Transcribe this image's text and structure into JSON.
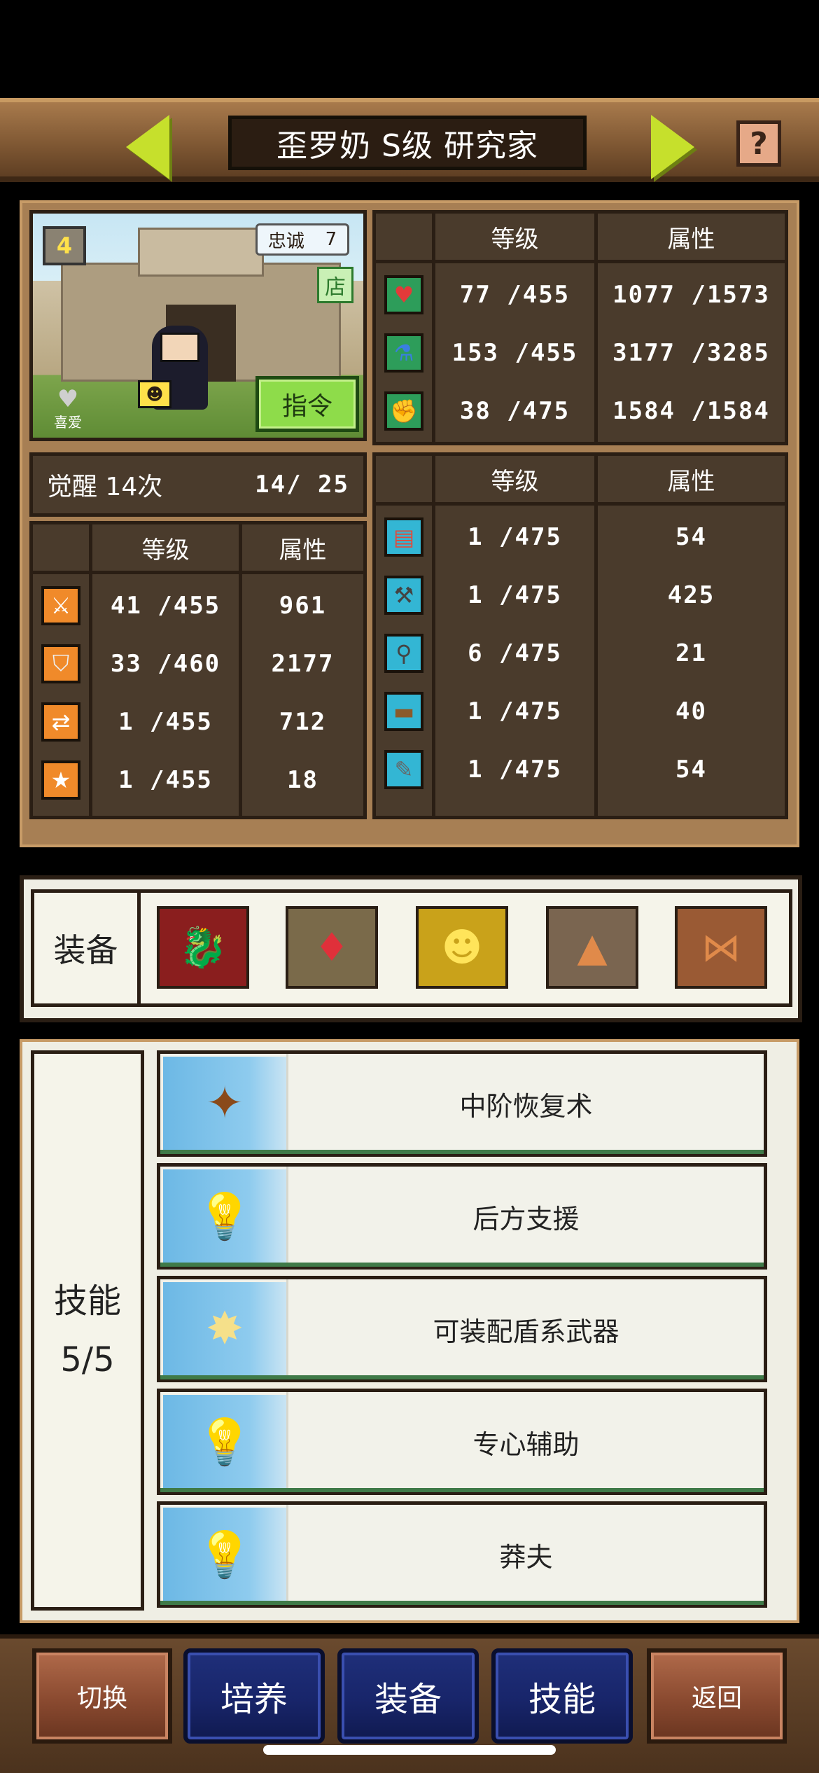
{
  "header": {
    "title": "歪罗奶 S级 研究家",
    "prev_icon": "left-arrow-icon",
    "next_icon": "right-arrow-icon",
    "help_label": "?"
  },
  "portrait": {
    "level_badge": "4",
    "loyalty_label": "忠诚",
    "loyalty_value": "7",
    "shop_label": "店",
    "favorite_label": "喜爱",
    "command_label": "指令"
  },
  "top_stats": {
    "headers": {
      "level": "等级",
      "attr": "属性"
    },
    "rows": [
      {
        "icon": "heart-icon",
        "level": "77 /455",
        "attr": "1077 /1573"
      },
      {
        "icon": "potion-icon",
        "level": "153 /455",
        "attr": "3177 /3285"
      },
      {
        "icon": "muscle-icon",
        "level": "38 /475",
        "attr": "1584 /1584"
      }
    ]
  },
  "awaken": {
    "label": "觉醒 14次",
    "value": "14/  25"
  },
  "left_stats": {
    "headers": {
      "level": "等级",
      "attr": "属性"
    },
    "rows": [
      {
        "icon": "sword-icon",
        "level": "41 /455",
        "attr": "961"
      },
      {
        "icon": "shield-icon",
        "level": "33 /460",
        "attr": "2177"
      },
      {
        "icon": "speed-icon",
        "level": "1 /455",
        "attr": "712"
      },
      {
        "icon": "star-icon",
        "level": "1 /455",
        "attr": "18"
      }
    ]
  },
  "right_stats": {
    "headers": {
      "level": "等级",
      "attr": "属性"
    },
    "rows": [
      {
        "icon": "scroll-icon",
        "level": "1 /475",
        "attr": "54"
      },
      {
        "icon": "pickaxe-icon",
        "level": "1 /475",
        "attr": "425"
      },
      {
        "icon": "shovel-icon",
        "level": "6 /475",
        "attr": "21"
      },
      {
        "icon": "anvil-icon",
        "level": "1 /475",
        "attr": "40"
      },
      {
        "icon": "wrench-icon",
        "level": "1 /475",
        "attr": "54"
      }
    ]
  },
  "equipment": {
    "label": "装备",
    "items": [
      {
        "icon": "dragon-head-icon",
        "glyph": "🐉",
        "bg": "#8a1e1e"
      },
      {
        "icon": "red-gem-icon",
        "glyph": "♦",
        "bg": "#7a6a4a"
      },
      {
        "icon": "smile-block-icon",
        "glyph": "☻",
        "bg": "#c9a21a"
      },
      {
        "icon": "cloak-icon",
        "glyph": "▲",
        "bg": "#7a6550"
      },
      {
        "icon": "bow-tie-icon",
        "glyph": "⋈",
        "bg": "#9a5a34"
      }
    ]
  },
  "skills": {
    "label": "技能",
    "count": "5/5",
    "items": [
      {
        "name": "中阶恢复术",
        "icon": "magic-wand-icon",
        "glyph": "✦"
      },
      {
        "name": "后方支援",
        "icon": "lightbulb-icon",
        "glyph": "💡"
      },
      {
        "name": "可装配盾系武器",
        "icon": "burst-shield-icon",
        "glyph": "✸"
      },
      {
        "name": "专心辅助",
        "icon": "lightbulb-icon",
        "glyph": "💡"
      },
      {
        "name": "莽夫",
        "icon": "lightbulb-icon",
        "glyph": "💡"
      }
    ]
  },
  "bottom_nav": {
    "switch": "切换",
    "train": "培养",
    "equip": "装备",
    "skill": "技能",
    "back": "返回"
  }
}
